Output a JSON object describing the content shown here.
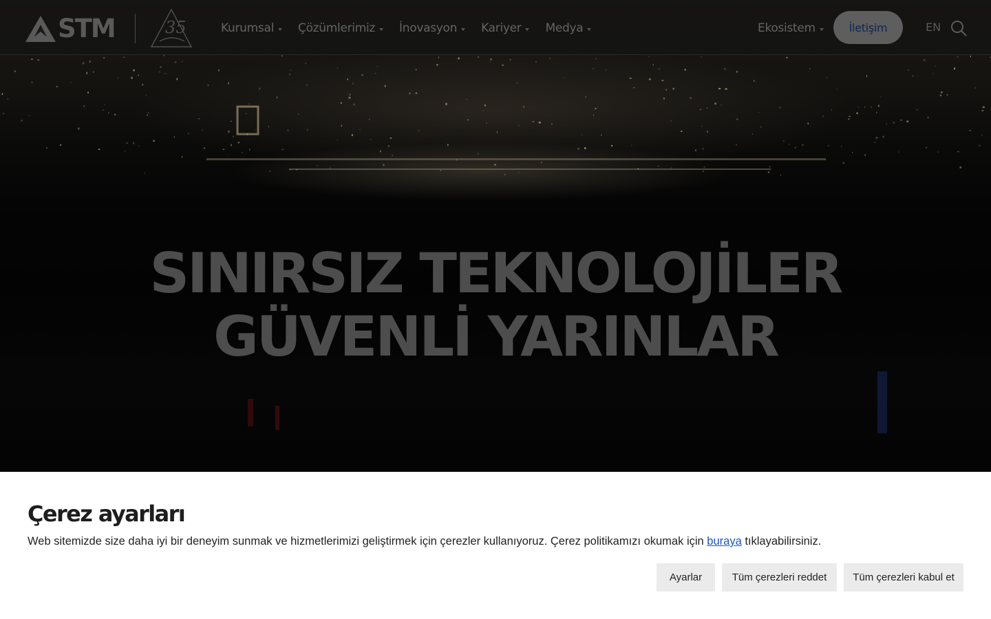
{
  "header": {
    "logo_text": "STM",
    "nav": [
      {
        "label": "Kurumsal"
      },
      {
        "label": "Çözümlerimiz"
      },
      {
        "label": "İnovasyon"
      },
      {
        "label": "Kariyer"
      },
      {
        "label": "Medya"
      }
    ],
    "ecosystem_label": "Ekosistem",
    "contact_label": "İletişim",
    "language_label": "EN"
  },
  "hero": {
    "title_line1": "SINIRSIZ TEKNOLOJİLER",
    "title_line2": "GÜVENLİ YARINLAR"
  },
  "cookie_banner": {
    "title": "Çerez ayarları",
    "text_before_link": "Web sitemizde size daha iyi bir deneyim sunmak ve hizmetlerimizi geliştirmek için çerezler kullanıyoruz. Çerez politikamızı okumak için ",
    "link_text": "buraya",
    "text_after_link": " tıklayabilirsiniz.",
    "buttons": {
      "settings": "Ayarlar",
      "reject_all": "Tüm çerezleri reddet",
      "accept_all": "Tüm çerezleri kabul et"
    }
  },
  "icons": {
    "search": "search-icon",
    "logo": "stm-logo-icon",
    "anniversary": "35-year-anniversary-icon"
  },
  "colors": {
    "header_bg": "#141414",
    "contact_button_bg": "#5e5e5e",
    "contact_button_text": "#0d2555",
    "cookie_link": "#1a56b8",
    "cookie_button_bg": "#ebebeb"
  }
}
